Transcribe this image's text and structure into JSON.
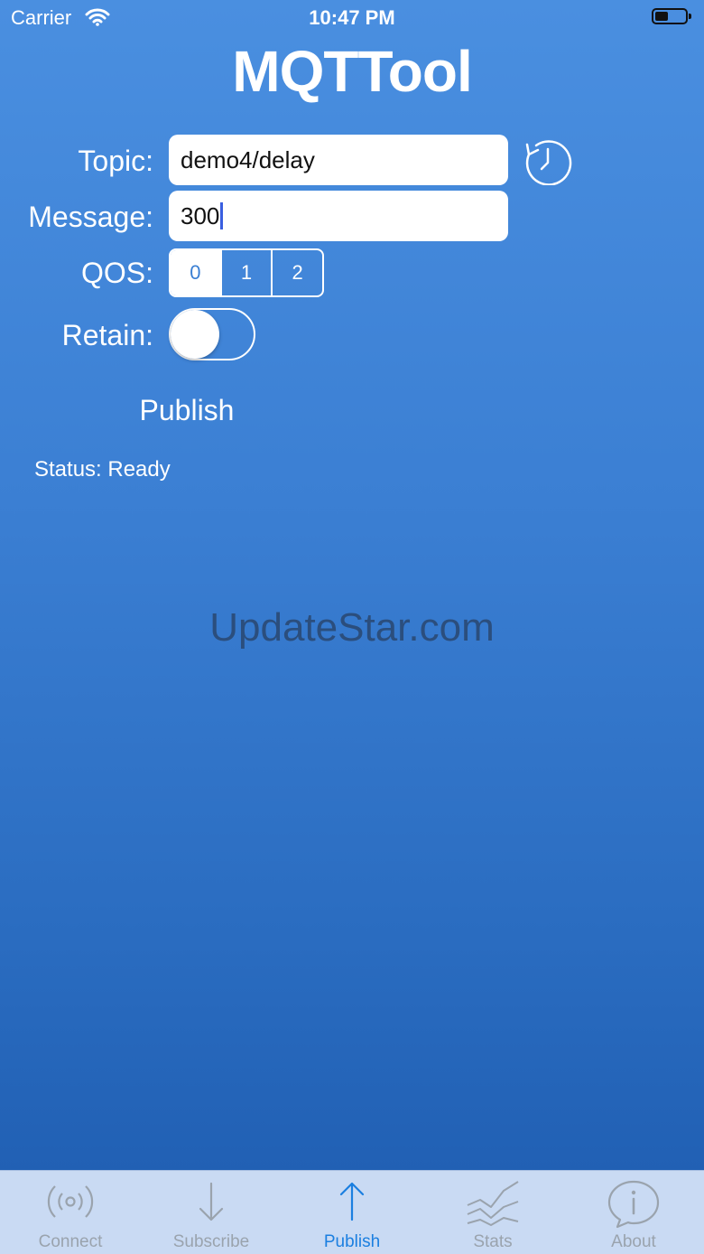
{
  "status_bar": {
    "carrier": "Carrier",
    "time": "10:47 PM"
  },
  "app": {
    "title": "MQTTool"
  },
  "form": {
    "topic_label": "Topic:",
    "topic_value": "demo4/delay",
    "message_label": "Message:",
    "message_value": "300",
    "qos_label": "QOS:",
    "qos_options": [
      "0",
      "1",
      "2"
    ],
    "qos_selected": "0",
    "retain_label": "Retain:",
    "retain_on": false
  },
  "publish_label": "Publish",
  "status_text": "Status: Ready",
  "watermark": "UpdateStar.com",
  "tabs": [
    {
      "label": "Connect",
      "icon": "antenna-icon",
      "active": false
    },
    {
      "label": "Subscribe",
      "icon": "arrow-down-icon",
      "active": false
    },
    {
      "label": "Publish",
      "icon": "arrow-up-icon",
      "active": true
    },
    {
      "label": "Stats",
      "icon": "chart-icon",
      "active": false
    },
    {
      "label": "About",
      "icon": "info-bubble-icon",
      "active": false
    }
  ],
  "colors": {
    "accent": "#1b7fe0",
    "background_top": "#4a8fe0",
    "background_bottom": "#1e5cb0",
    "tabbar": "#c9daf3"
  }
}
